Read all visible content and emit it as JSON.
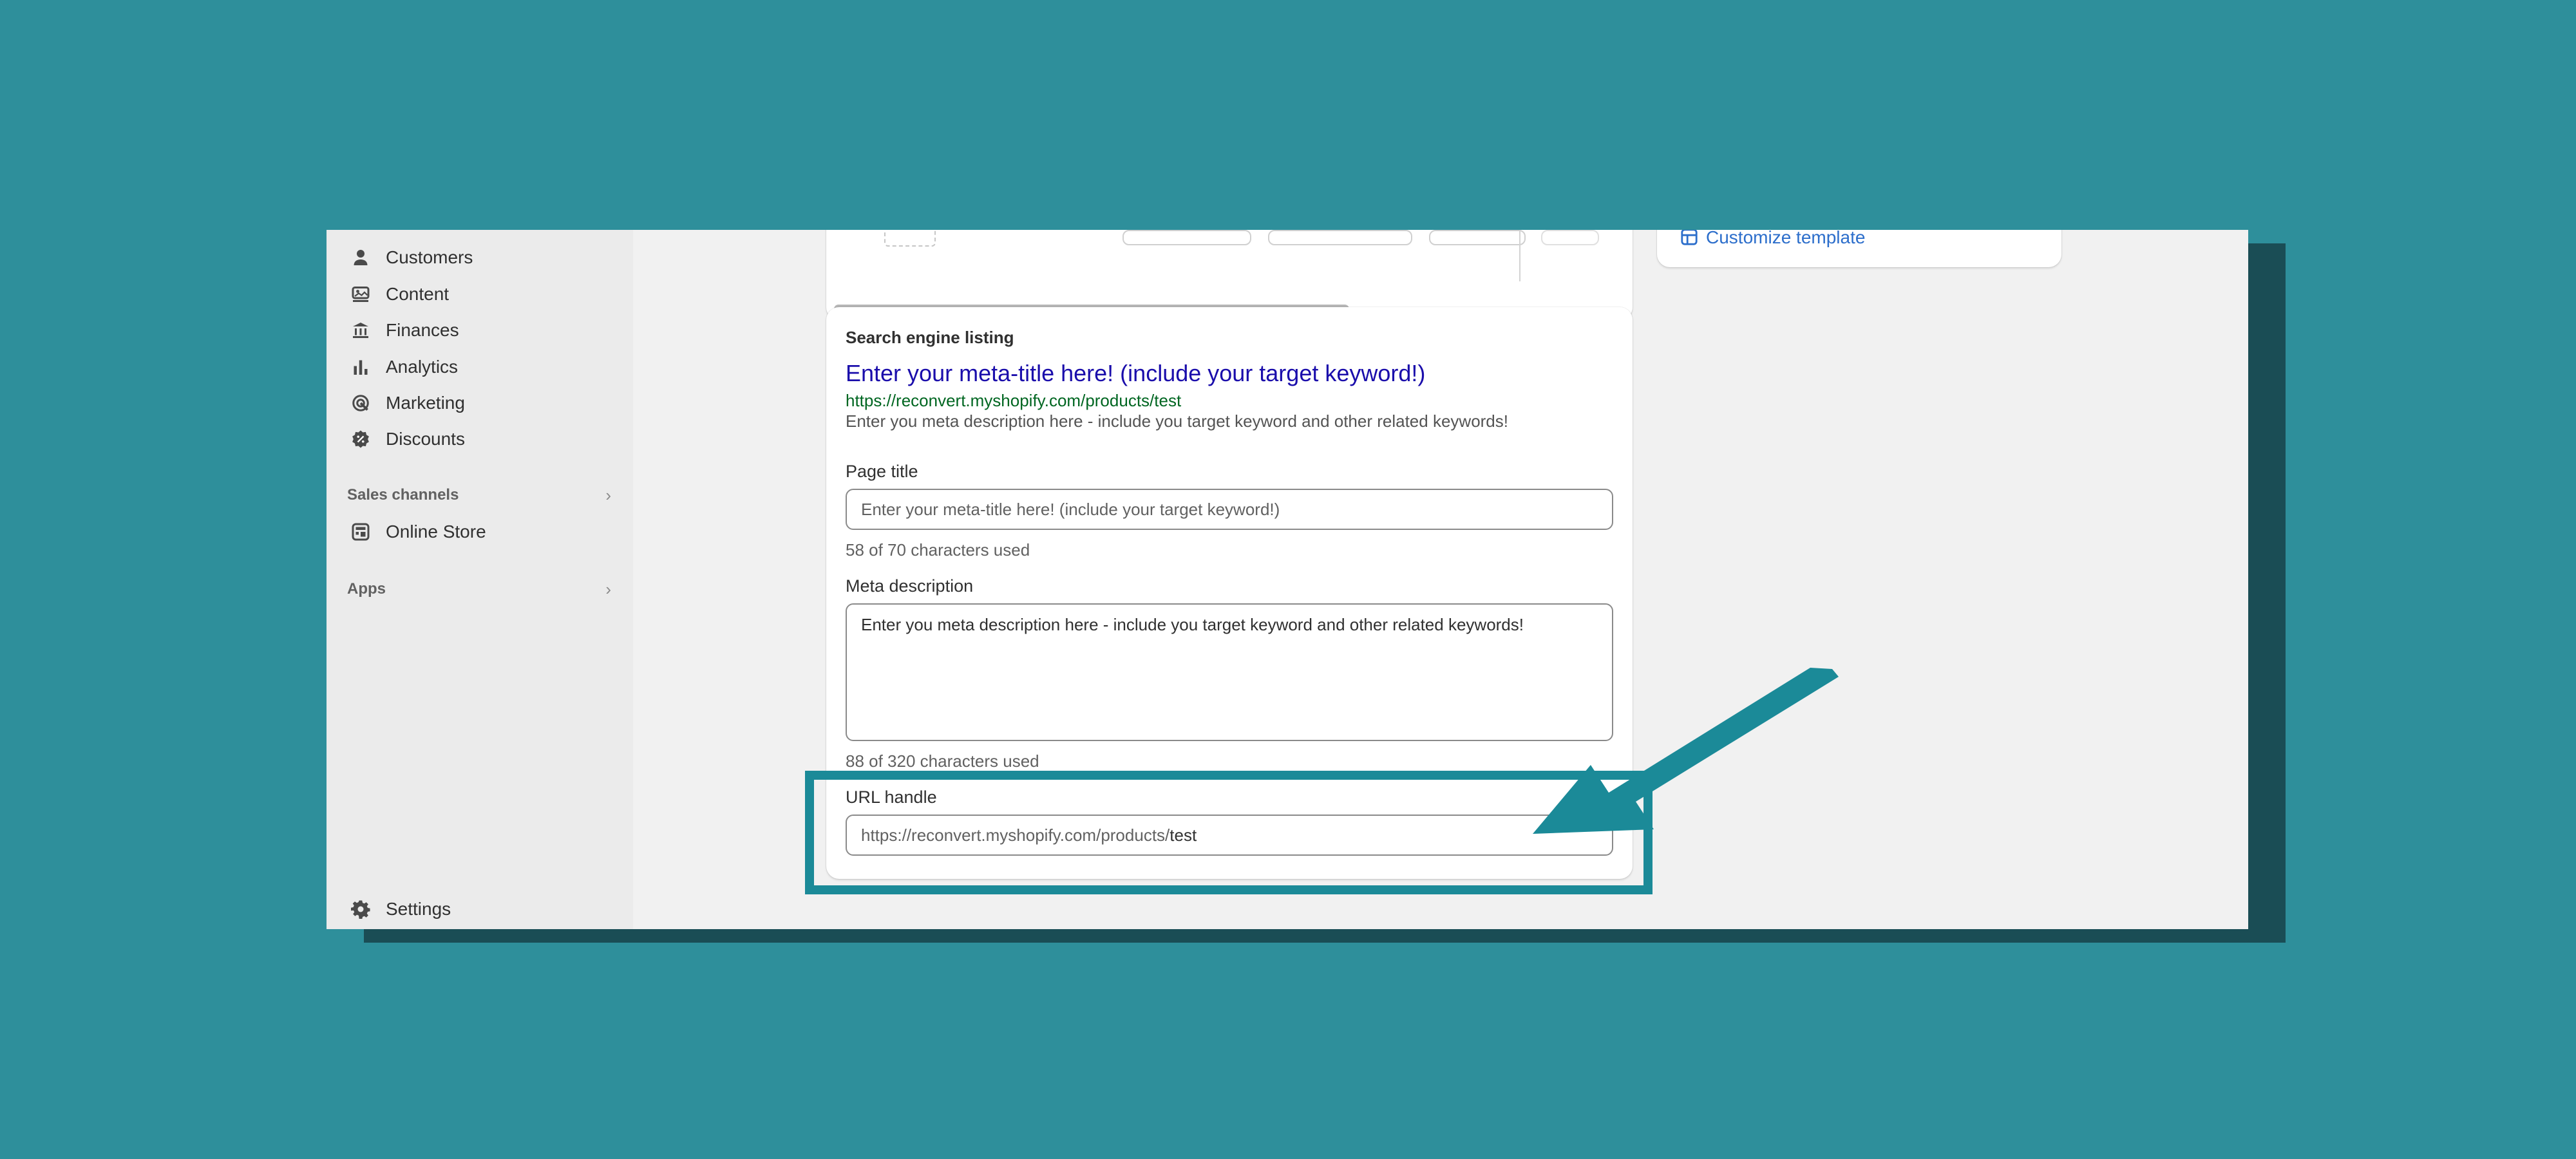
{
  "sidebar": {
    "items": [
      {
        "label": "Customers",
        "icon": "person-icon"
      },
      {
        "label": "Content",
        "icon": "content-icon"
      },
      {
        "label": "Finances",
        "icon": "bank-icon"
      },
      {
        "label": "Analytics",
        "icon": "bar-chart-icon"
      },
      {
        "label": "Marketing",
        "icon": "target-icon"
      },
      {
        "label": "Discounts",
        "icon": "discount-icon"
      }
    ],
    "sales_channels_label": "Sales channels",
    "online_store_label": "Online Store",
    "apps_label": "Apps",
    "settings_label": "Settings"
  },
  "right_card": {
    "customize_label": "Customize template"
  },
  "seo": {
    "title": "Search engine listing",
    "preview": {
      "title": "Enter your meta-title here! (include your target keyword!)",
      "url": "https://reconvert.myshopify.com/products/test",
      "description": "Enter you meta description here - include you target keyword and other related keywords!"
    },
    "page_title": {
      "label": "Page title",
      "value": "Enter your meta-title here! (include your target keyword!)",
      "help": "58 of 70 characters used"
    },
    "meta_description": {
      "label": "Meta description",
      "value": "Enter you meta description here - include you target keyword and other related keywords!",
      "help": "88 of 320 characters used"
    },
    "url_handle": {
      "label": "URL handle",
      "prefix": "https://reconvert.myshopify.com/products/",
      "value": "test"
    }
  },
  "colors": {
    "background": "#2e8f9b",
    "highlight": "#1b8a98",
    "link": "#2c6ecb",
    "preview_title": "#1a0dab",
    "preview_url": "#006621"
  }
}
